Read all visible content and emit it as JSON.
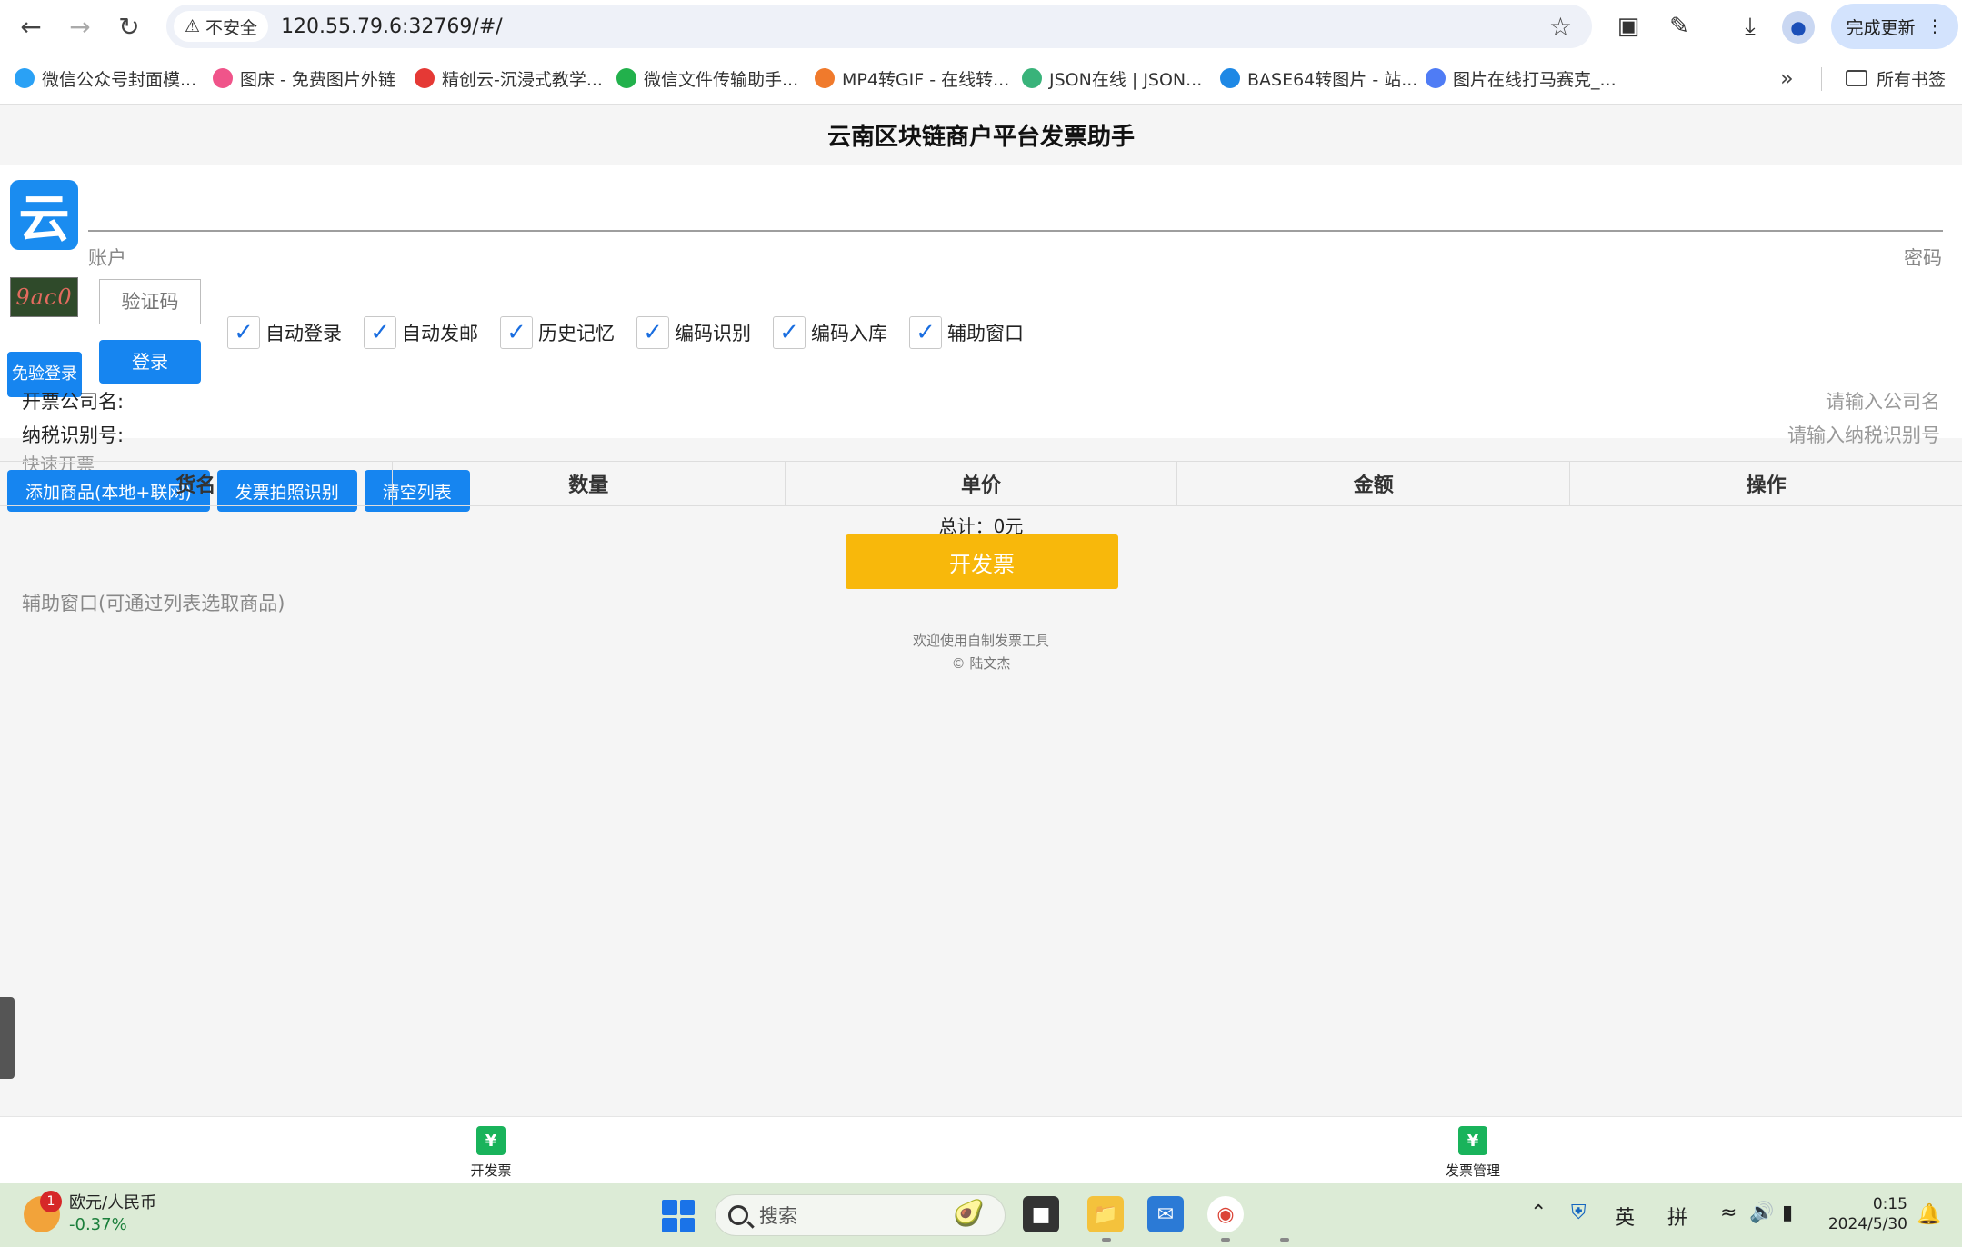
{
  "browser": {
    "security_label": "不安全",
    "url": "120.55.79.6:32769/#/",
    "update_label": "完成更新",
    "bookmarks": [
      {
        "label": "微信公众号封面模...",
        "color": "#2aa1f5"
      },
      {
        "label": "图床 - 免费图片外链",
        "color": "#f0548a"
      },
      {
        "label": "精创云-沉浸式教学...",
        "color": "#e53935"
      },
      {
        "label": "微信文件传输助手...",
        "color": "#22b14c"
      },
      {
        "label": "MP4转GIF - 在线转...",
        "color": "#f07a2c"
      },
      {
        "label": "JSON在线 | JSON...",
        "color": "#39b37a"
      },
      {
        "label": "BASE64转图片 - 站...",
        "color": "#1e88e5"
      },
      {
        "label": "图片在线打马赛克_...",
        "color": "#4f7cf5"
      }
    ],
    "all_bookmarks_label": "所有书签"
  },
  "app": {
    "title": "云南区块链商户平台发票助手",
    "logo_char": "云",
    "account_label": "账户",
    "password_label": "密码",
    "captcha_text": "9ac0",
    "captcha_placeholder": "验证码",
    "free_login_label": "免验登录",
    "login_label": "登录",
    "checkboxes": [
      {
        "label": "自动登录",
        "checked": true
      },
      {
        "label": "自动发邮",
        "checked": true
      },
      {
        "label": "历史记忆",
        "checked": true
      },
      {
        "label": "编码识别",
        "checked": true
      },
      {
        "label": "编码入库",
        "checked": true
      },
      {
        "label": "辅助窗口",
        "checked": true
      }
    ],
    "quick_title": "快速开票",
    "quick_buttons": [
      "添加商品(本地+联网)",
      "发票拍照识别",
      "清空列表"
    ],
    "company_label": "开票公司名:",
    "company_placeholder": "请输入公司名",
    "tax_label": "纳税识别号:",
    "tax_placeholder": "请输入纳税识别号",
    "table_headers": [
      "货名",
      "数量",
      "单价",
      "金额",
      "操作"
    ],
    "total_text": "总计：0元",
    "invoice_button": "开发票",
    "aux_title": "辅助窗口(可通过列表选取商品)",
    "footer_line1": "欢迎使用自制发票工具",
    "footer_line2": "© 陆文杰",
    "tabs": [
      {
        "label": "开发票",
        "icon": "invoice-icon"
      },
      {
        "label": "发票管理",
        "icon": "invoice-manage-icon"
      }
    ],
    "colors": {
      "primary": "#1685f0",
      "invoice_button": "#f8b80b",
      "tab_icon": "#19b35b"
    }
  },
  "taskbar": {
    "widget_title": "欧元/人民币",
    "widget_change": "-0.37%",
    "widget_badge": "1",
    "search_placeholder": "搜索",
    "ime_lang": "英",
    "ime_mode": "拼",
    "time": "0:15",
    "date": "2024/5/30"
  }
}
